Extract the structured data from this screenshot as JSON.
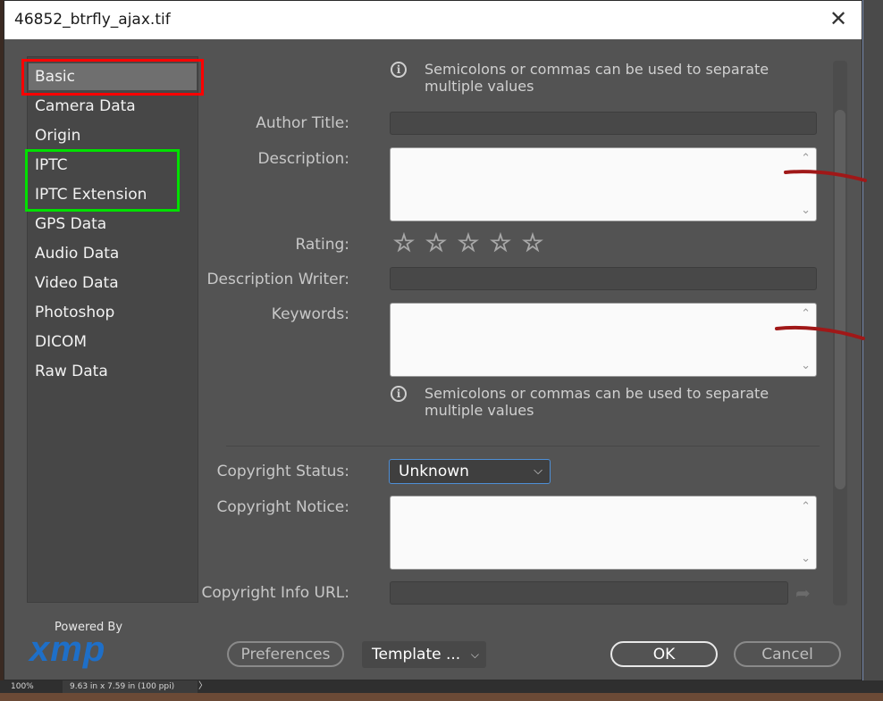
{
  "window": {
    "title": "46852_btrfly_ajax.tif",
    "close_glyph": "✕"
  },
  "nav": {
    "items": [
      {
        "label": "Basic"
      },
      {
        "label": "Camera Data"
      },
      {
        "label": "Origin"
      },
      {
        "label": "IPTC"
      },
      {
        "label": "IPTC Extension"
      },
      {
        "label": "GPS Data"
      },
      {
        "label": "Audio Data"
      },
      {
        "label": "Video Data"
      },
      {
        "label": "Photoshop"
      },
      {
        "label": "DICOM"
      },
      {
        "label": "Raw Data"
      }
    ],
    "selected": "Basic"
  },
  "form": {
    "info_top": "Semicolons or commas can be used to separate multiple values",
    "info_bottom": "Semicolons or commas can be used to separate multiple values",
    "info_icon": "i",
    "author_title_label": "Author Title:",
    "author_title_value": "",
    "description_label": "Description:",
    "description_value": "",
    "rating_label": "Rating:",
    "rating_value": 0,
    "rating_max": 5,
    "star_glyph": "☆",
    "description_writer_label": "Description Writer:",
    "description_writer_value": "",
    "keywords_label": "Keywords:",
    "keywords_value": "",
    "copyright_status_label": "Copyright Status:",
    "copyright_status_value": "Unknown",
    "copyright_notice_label": "Copyright Notice:",
    "copyright_notice_value": "",
    "copyright_url_label": "Copyright Info URL:",
    "copyright_url_value": "",
    "scroll_up": "⌃",
    "scroll_down": "⌄",
    "chevron": "⌵",
    "goto_arrow": "➦"
  },
  "footer": {
    "powered_by": "Powered By",
    "logo": "xmp",
    "preferences_label": "Preferences",
    "template_label": "Template ...",
    "ok_label": "OK",
    "cancel_label": "Cancel"
  },
  "statusbar": {
    "zoom": "100%",
    "doc_size": "9.63 in x 7.59 in (100 ppi)",
    "chevron": "〉"
  },
  "colors": {
    "selection_highlight": "#ff0000",
    "iptc_highlight": "#00e000",
    "annotation_stroke": "#a01818",
    "focus_border": "#4e8fd6",
    "xmp_blue": "#1e6fc8"
  },
  "icons": [
    "close-icon",
    "info-icon",
    "star-icon",
    "chevron-down-icon",
    "scroll-arrow-icon",
    "goto-url-icon"
  ]
}
